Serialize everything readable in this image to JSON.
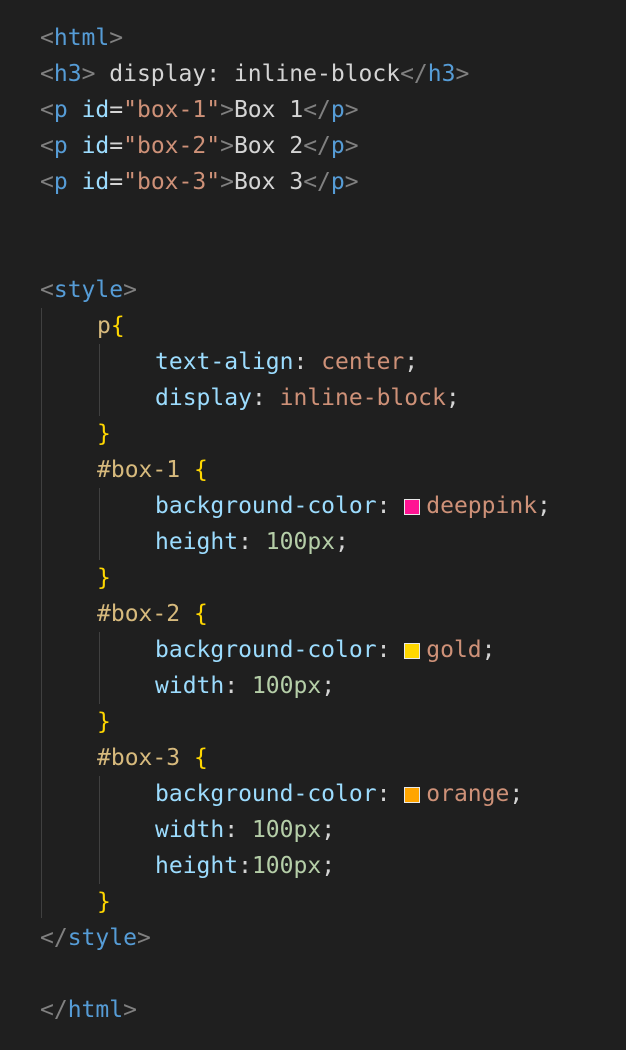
{
  "html_open": {
    "lt": "<",
    "name": "html",
    "gt": ">"
  },
  "h3": {
    "open_lt": "<",
    "open_name": "h3",
    "open_gt": ">",
    "content": " display: inline-block",
    "close_lt": "</",
    "close_name": "h3",
    "close_gt": ">"
  },
  "paragraphs": [
    {
      "lt": "<",
      "tag": "p",
      "attr": "id",
      "eq": "=",
      "value": "\"box-1\"",
      "gt": ">",
      "content": "Box 1",
      "close_lt": "</",
      "close_tag": "p",
      "close_gt": ">"
    },
    {
      "lt": "<",
      "tag": "p",
      "attr": "id",
      "eq": "=",
      "value": "\"box-2\"",
      "gt": ">",
      "content": "Box 2",
      "close_lt": "</",
      "close_tag": "p",
      "close_gt": ">"
    },
    {
      "lt": "<",
      "tag": "p",
      "attr": "id",
      "eq": "=",
      "value": "\"box-3\"",
      "gt": ">",
      "content": "Box 3",
      "close_lt": "</",
      "close_tag": "p",
      "close_gt": ">"
    }
  ],
  "style_open": {
    "lt": "<",
    "name": "style",
    "gt": ">"
  },
  "rules": {
    "p": {
      "selector": "p",
      "open": "{",
      "decls": [
        {
          "prop": "text-align",
          "colon": ": ",
          "value": "center",
          "semi": ";"
        },
        {
          "prop": "display",
          "colon": ": ",
          "value": "inline-block",
          "semi": ";"
        }
      ],
      "close": "}"
    },
    "box1": {
      "selector": "#box-1 ",
      "open": "{",
      "decls": [
        {
          "prop": "background-color",
          "colon": ": ",
          "value": "deeppink",
          "semi": ";",
          "swatch": "#ff1493"
        },
        {
          "prop": "height",
          "colon": ": ",
          "value": "100px",
          "semi": ";"
        }
      ],
      "close": "}"
    },
    "box2": {
      "selector": "#box-2 ",
      "open": "{",
      "decls": [
        {
          "prop": "background-color",
          "colon": ": ",
          "value": "gold",
          "semi": ";",
          "swatch": "#ffd700"
        },
        {
          "prop": "width",
          "colon": ": ",
          "value": "100px",
          "semi": ";"
        }
      ],
      "close": "}"
    },
    "box3": {
      "selector": "#box-3 ",
      "open": "{",
      "decls": [
        {
          "prop": "background-color",
          "colon": ": ",
          "value": "orange",
          "semi": ";",
          "swatch": "#ffa500"
        },
        {
          "prop": "width",
          "colon": ": ",
          "value": "100px",
          "semi": ";"
        },
        {
          "prop": "height",
          "colon": ":",
          "value": "100px",
          "semi": ";"
        }
      ],
      "close": "}"
    }
  },
  "style_close": {
    "lt": "</",
    "name": "style",
    "gt": ">"
  },
  "html_close": {
    "lt": "</",
    "name": "html",
    "gt": ">"
  },
  "colors": {
    "background": "#1f1f1f",
    "tag": "#569cd6",
    "attribute": "#9cdcfe",
    "string": "#ce9178",
    "number": "#b5cea8",
    "selector": "#d7ba7d",
    "brace": "#ffd700"
  }
}
